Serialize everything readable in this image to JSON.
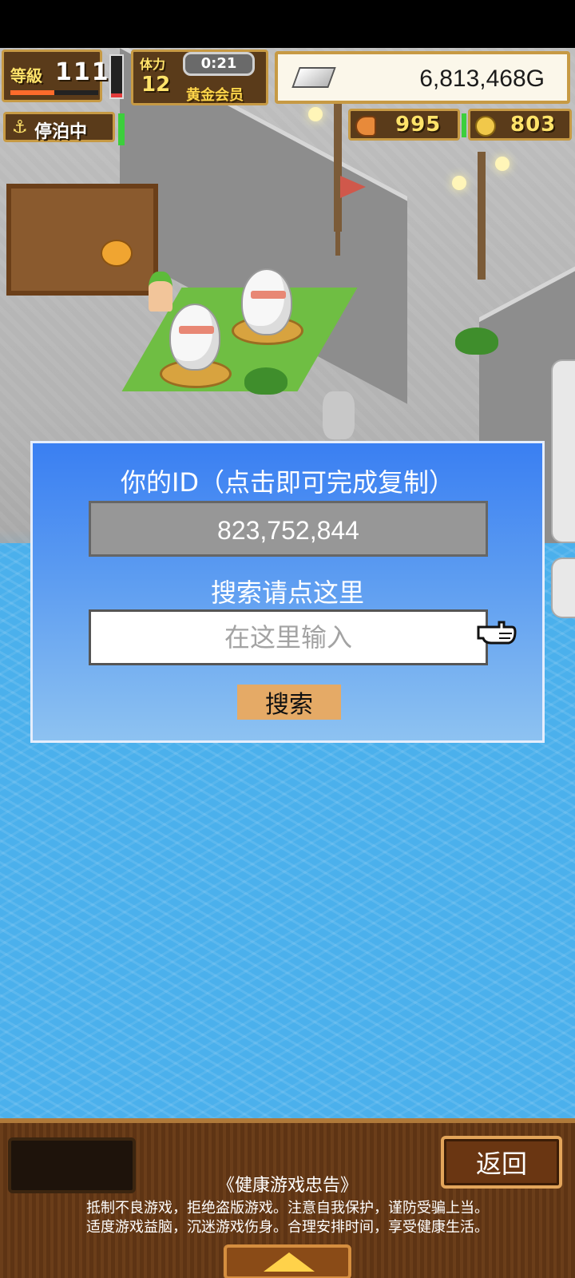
{
  "hud": {
    "level_label": "等級",
    "level_value": "111",
    "level_progress": 0.5,
    "hp_progress": 0.1,
    "stamina_label": "体力",
    "stamina_value": "12",
    "timer": "0:21",
    "membership": "黄金会员",
    "gold": "6,813,468G",
    "status": "停泊中",
    "resource_1": "995",
    "resource_2": "803"
  },
  "dialog": {
    "title": "你的ID（点击即可完成复制）",
    "id_value": "823,752,844",
    "search_hint": "搜索请点这里",
    "search_placeholder": "在这里输入",
    "search_button": "搜索"
  },
  "bottom": {
    "back_button": "返回",
    "notice_title": "《健康游戏忠告》",
    "notice_line_1": "抵制不良游戏，拒绝盗版游戏。注意自我保护，谨防受骗上当。",
    "notice_line_2": "适度游戏益脑，沉迷游戏伤身。合理安排时间，享受健康生活。"
  },
  "icons": [
    "anchor-icon",
    "silver-ingot-icon",
    "fish-icon",
    "coin-icon",
    "pointing-hand-icon",
    "up-arrow-icon"
  ],
  "colors": {
    "dialog_top": "#3a7ff2",
    "dialog_bottom": "#8dc2f1",
    "search_button": "#e5aa66",
    "hud_brown": "#5a3b1a",
    "hud_gold": "#c79a44"
  }
}
